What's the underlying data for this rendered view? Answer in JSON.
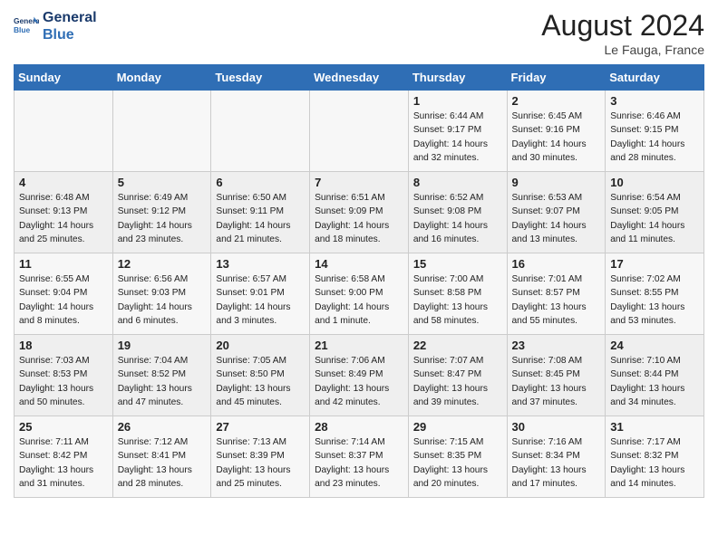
{
  "header": {
    "logo_line1": "General",
    "logo_line2": "Blue",
    "month_year": "August 2024",
    "location": "Le Fauga, France"
  },
  "days_of_week": [
    "Sunday",
    "Monday",
    "Tuesday",
    "Wednesday",
    "Thursday",
    "Friday",
    "Saturday"
  ],
  "weeks": [
    [
      {
        "day": "",
        "detail": ""
      },
      {
        "day": "",
        "detail": ""
      },
      {
        "day": "",
        "detail": ""
      },
      {
        "day": "",
        "detail": ""
      },
      {
        "day": "1",
        "detail": "Sunrise: 6:44 AM\nSunset: 9:17 PM\nDaylight: 14 hours\nand 32 minutes."
      },
      {
        "day": "2",
        "detail": "Sunrise: 6:45 AM\nSunset: 9:16 PM\nDaylight: 14 hours\nand 30 minutes."
      },
      {
        "day": "3",
        "detail": "Sunrise: 6:46 AM\nSunset: 9:15 PM\nDaylight: 14 hours\nand 28 minutes."
      }
    ],
    [
      {
        "day": "4",
        "detail": "Sunrise: 6:48 AM\nSunset: 9:13 PM\nDaylight: 14 hours\nand 25 minutes."
      },
      {
        "day": "5",
        "detail": "Sunrise: 6:49 AM\nSunset: 9:12 PM\nDaylight: 14 hours\nand 23 minutes."
      },
      {
        "day": "6",
        "detail": "Sunrise: 6:50 AM\nSunset: 9:11 PM\nDaylight: 14 hours\nand 21 minutes."
      },
      {
        "day": "7",
        "detail": "Sunrise: 6:51 AM\nSunset: 9:09 PM\nDaylight: 14 hours\nand 18 minutes."
      },
      {
        "day": "8",
        "detail": "Sunrise: 6:52 AM\nSunset: 9:08 PM\nDaylight: 14 hours\nand 16 minutes."
      },
      {
        "day": "9",
        "detail": "Sunrise: 6:53 AM\nSunset: 9:07 PM\nDaylight: 14 hours\nand 13 minutes."
      },
      {
        "day": "10",
        "detail": "Sunrise: 6:54 AM\nSunset: 9:05 PM\nDaylight: 14 hours\nand 11 minutes."
      }
    ],
    [
      {
        "day": "11",
        "detail": "Sunrise: 6:55 AM\nSunset: 9:04 PM\nDaylight: 14 hours\nand 8 minutes."
      },
      {
        "day": "12",
        "detail": "Sunrise: 6:56 AM\nSunset: 9:03 PM\nDaylight: 14 hours\nand 6 minutes."
      },
      {
        "day": "13",
        "detail": "Sunrise: 6:57 AM\nSunset: 9:01 PM\nDaylight: 14 hours\nand 3 minutes."
      },
      {
        "day": "14",
        "detail": "Sunrise: 6:58 AM\nSunset: 9:00 PM\nDaylight: 14 hours\nand 1 minute."
      },
      {
        "day": "15",
        "detail": "Sunrise: 7:00 AM\nSunset: 8:58 PM\nDaylight: 13 hours\nand 58 minutes."
      },
      {
        "day": "16",
        "detail": "Sunrise: 7:01 AM\nSunset: 8:57 PM\nDaylight: 13 hours\nand 55 minutes."
      },
      {
        "day": "17",
        "detail": "Sunrise: 7:02 AM\nSunset: 8:55 PM\nDaylight: 13 hours\nand 53 minutes."
      }
    ],
    [
      {
        "day": "18",
        "detail": "Sunrise: 7:03 AM\nSunset: 8:53 PM\nDaylight: 13 hours\nand 50 minutes."
      },
      {
        "day": "19",
        "detail": "Sunrise: 7:04 AM\nSunset: 8:52 PM\nDaylight: 13 hours\nand 47 minutes."
      },
      {
        "day": "20",
        "detail": "Sunrise: 7:05 AM\nSunset: 8:50 PM\nDaylight: 13 hours\nand 45 minutes."
      },
      {
        "day": "21",
        "detail": "Sunrise: 7:06 AM\nSunset: 8:49 PM\nDaylight: 13 hours\nand 42 minutes."
      },
      {
        "day": "22",
        "detail": "Sunrise: 7:07 AM\nSunset: 8:47 PM\nDaylight: 13 hours\nand 39 minutes."
      },
      {
        "day": "23",
        "detail": "Sunrise: 7:08 AM\nSunset: 8:45 PM\nDaylight: 13 hours\nand 37 minutes."
      },
      {
        "day": "24",
        "detail": "Sunrise: 7:10 AM\nSunset: 8:44 PM\nDaylight: 13 hours\nand 34 minutes."
      }
    ],
    [
      {
        "day": "25",
        "detail": "Sunrise: 7:11 AM\nSunset: 8:42 PM\nDaylight: 13 hours\nand 31 minutes."
      },
      {
        "day": "26",
        "detail": "Sunrise: 7:12 AM\nSunset: 8:41 PM\nDaylight: 13 hours\nand 28 minutes."
      },
      {
        "day": "27",
        "detail": "Sunrise: 7:13 AM\nSunset: 8:39 PM\nDaylight: 13 hours\nand 25 minutes."
      },
      {
        "day": "28",
        "detail": "Sunrise: 7:14 AM\nSunset: 8:37 PM\nDaylight: 13 hours\nand 23 minutes."
      },
      {
        "day": "29",
        "detail": "Sunrise: 7:15 AM\nSunset: 8:35 PM\nDaylight: 13 hours\nand 20 minutes."
      },
      {
        "day": "30",
        "detail": "Sunrise: 7:16 AM\nSunset: 8:34 PM\nDaylight: 13 hours\nand 17 minutes."
      },
      {
        "day": "31",
        "detail": "Sunrise: 7:17 AM\nSunset: 8:32 PM\nDaylight: 13 hours\nand 14 minutes."
      }
    ]
  ]
}
